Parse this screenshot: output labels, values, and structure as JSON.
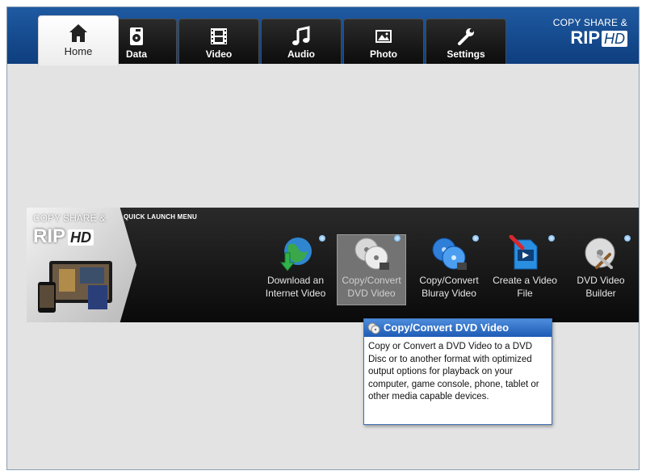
{
  "tabs": [
    {
      "label": "Home",
      "icon": "home-icon",
      "active": true
    },
    {
      "label": "Data",
      "icon": "data-disc-icon",
      "active": false
    },
    {
      "label": "Video",
      "icon": "film-icon",
      "active": false
    },
    {
      "label": "Audio",
      "icon": "music-note-icon",
      "active": false
    },
    {
      "label": "Photo",
      "icon": "photo-icon",
      "active": false
    },
    {
      "label": "Settings",
      "icon": "wrench-icon",
      "active": false
    }
  ],
  "brand": {
    "line1": "COPY SHARE &",
    "line2": "RIP",
    "badge": "HD"
  },
  "quick_launch": {
    "title": "QUICK LAUNCH MENU",
    "banner": {
      "line1": "COPY SHARE &",
      "line2": "RIP",
      "badge": "HD"
    },
    "items": [
      {
        "label_line1": "Download an",
        "label_line2": "Internet Video",
        "icon": "globe-download-icon"
      },
      {
        "label_line1": "Copy/Convert",
        "label_line2": "DVD Video",
        "icon": "dvd-discs-icon",
        "highlighted": true
      },
      {
        "label_line1": "Copy/Convert",
        "label_line2": "Bluray Video",
        "icon": "bluray-discs-icon"
      },
      {
        "label_line1": "Create a Video",
        "label_line2": "File",
        "icon": "video-file-icon"
      },
      {
        "label_line1": "DVD Video",
        "label_line2": "Builder",
        "icon": "dvd-builder-icon"
      }
    ]
  },
  "tooltip": {
    "title": "Copy/Convert DVD Video",
    "body": "Copy or Convert a DVD Video to a DVD Disc or to  another format with optimized output options for playback on your computer, game console, phone, tablet or other media capable devices."
  },
  "colors": {
    "accent_blue": "#1f5aa1",
    "tooltip_header": "#2d6bc4",
    "launch_bar": "#151515"
  }
}
